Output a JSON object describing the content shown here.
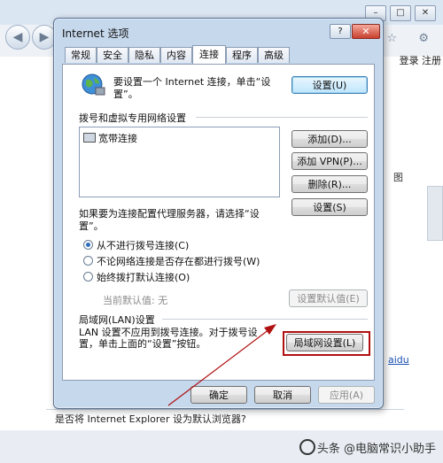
{
  "browser": {
    "right_link": "登录 注册",
    "tool_icons": "⌂ ☆ ⚙",
    "side_label_g": "图",
    "side_label_aidu": "aidu",
    "default_prompt": "是否将 Internet Explorer 设为默认浏览器?",
    "watermark": "头条 @电脑常识小助手"
  },
  "dialog": {
    "title": "Internet 选项",
    "help_label": "?",
    "close_label": "✕",
    "tabs": [
      {
        "label": "常规"
      },
      {
        "label": "安全"
      },
      {
        "label": "隐私"
      },
      {
        "label": "内容"
      },
      {
        "label": "连接"
      },
      {
        "label": "程序"
      },
      {
        "label": "高级"
      }
    ],
    "intro_text": "要设置一个 Internet 连接，单击“设置”。",
    "setup_button": "设置(U)",
    "dialup_section": "拨号和虚拟专用网络设置",
    "connection_item": "宽带连接",
    "add_button": "添加(D)...",
    "add_vpn_button": "添加 VPN(P)...",
    "delete_button": "删除(R)...",
    "proxy_text": "如果要为连接配置代理服务器，请选择“设置”。",
    "settings_button": "设置(S)",
    "radio_options": [
      {
        "label": "从不进行拨号连接(C)",
        "checked": true
      },
      {
        "label": "不论网络连接是否存在都进行拨号(W)",
        "checked": false
      },
      {
        "label": "始终拨打默认连接(O)",
        "checked": false
      }
    ],
    "current_default": "当前默认值: 无",
    "set_default_button": "设置默认值(E)",
    "lan_section": "局域网(LAN)设置",
    "lan_text": "LAN 设置不应用到拨号连接。对于拨号设置，单击上面的“设置”按钮。",
    "lan_button": "局域网设置(L)",
    "ok_button": "确定",
    "cancel_button": "取消",
    "apply_button": "应用(A)"
  },
  "colors": {
    "annotation_red": "#b01010",
    "dialog_frame": "#c6d8ec"
  }
}
